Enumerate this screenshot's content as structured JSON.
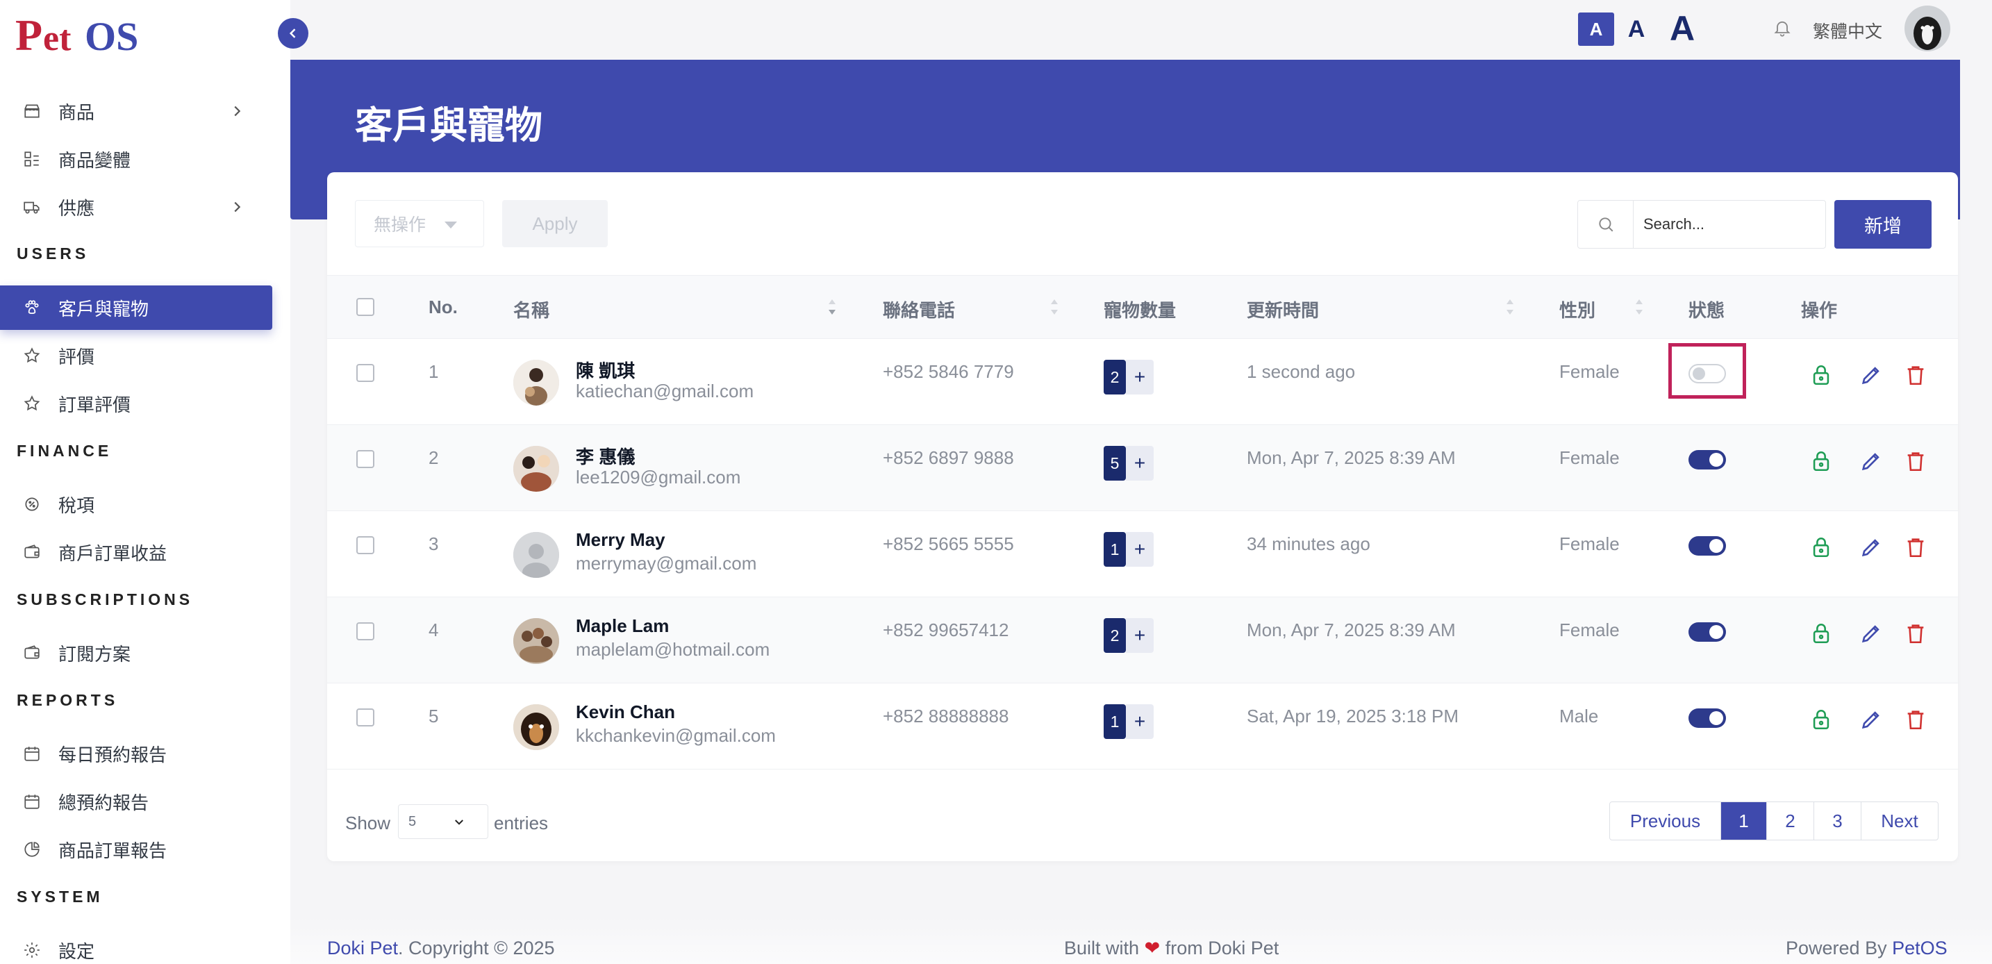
{
  "app": {
    "logo_text": "PetOS",
    "page_title": "客戶與寵物",
    "language": "繁體中文",
    "font_sizes": [
      "A",
      "A",
      "A"
    ]
  },
  "sidebar": {
    "items": [
      {
        "label": "商品",
        "icon": "store-icon",
        "has_children": true
      },
      {
        "label": "商品變體",
        "icon": "variant-icon",
        "has_children": false
      },
      {
        "label": "供應",
        "icon": "truck-icon",
        "has_children": true
      }
    ],
    "sections": [
      {
        "title": "USERS",
        "items": [
          {
            "label": "客戶與寵物",
            "icon": "paw-icon",
            "active": true
          },
          {
            "label": "評價",
            "icon": "star-icon"
          },
          {
            "label": "訂單評價",
            "icon": "star-icon"
          }
        ]
      },
      {
        "title": "FINANCE",
        "items": [
          {
            "label": "稅項",
            "icon": "tax-icon"
          },
          {
            "label": "商戶訂單收益",
            "icon": "wallet-icon"
          }
        ]
      },
      {
        "title": "SUBSCRIPTIONS",
        "items": [
          {
            "label": "訂閱方案",
            "icon": "wallet-icon"
          }
        ]
      },
      {
        "title": "REPORTS",
        "items": [
          {
            "label": "每日預約報告",
            "icon": "calendar-icon"
          },
          {
            "label": "總預約報告",
            "icon": "calendar-icon"
          },
          {
            "label": "商品訂單報告",
            "icon": "pie-chart-icon"
          }
        ]
      },
      {
        "title": "SYSTEM",
        "items": [
          {
            "label": "設定",
            "icon": "gear-icon"
          }
        ]
      }
    ]
  },
  "toolbar": {
    "bulk_action": "無操作",
    "apply_label": "Apply",
    "search_placeholder": "Search...",
    "add_label": "新增"
  },
  "table": {
    "columns": [
      "No.",
      "名稱",
      "聯絡電話",
      "寵物數量",
      "更新時間",
      "性別",
      "狀態",
      "操作"
    ],
    "rows": [
      {
        "no": "1",
        "name": "陳 凱琪",
        "email": "katiechan@gmail.com",
        "phone": "+852 5846 7779",
        "pets": "2",
        "updated": "1 second ago",
        "gender": "Female",
        "active": false
      },
      {
        "no": "2",
        "name": "李 惠儀",
        "email": "lee1209@gmail.com",
        "phone": "+852 6897 9888",
        "pets": "5",
        "updated": "Mon, Apr 7, 2025 8:39 AM",
        "gender": "Female",
        "active": true
      },
      {
        "no": "3",
        "name": "Merry May",
        "email": "merrymay@gmail.com",
        "phone": "+852 5665 5555",
        "pets": "1",
        "updated": "34 minutes ago",
        "gender": "Female",
        "active": true
      },
      {
        "no": "4",
        "name": "Maple Lam",
        "email": "maplelam@hotmail.com",
        "phone": "+852 99657412",
        "pets": "2",
        "updated": "Mon, Apr 7, 2025 8:39 AM",
        "gender": "Female",
        "active": true
      },
      {
        "no": "5",
        "name": "Kevin Chan",
        "email": "kkchankevin@gmail.com",
        "phone": "+852 88888888",
        "pets": "1",
        "updated": "Sat, Apr 19, 2025 3:18 PM",
        "gender": "Male",
        "active": true
      }
    ],
    "pet_add": "+"
  },
  "pagination": {
    "show_label": "Show",
    "entries_value": "5",
    "entries_label": "entries",
    "previous": "Previous",
    "pages": [
      "1",
      "2",
      "3"
    ],
    "current": "1",
    "next": "Next"
  },
  "footer": {
    "brand": "Doki Pet",
    "copyright": ". Copyright © 2025",
    "built_prefix": "Built with",
    "heart": "❤",
    "built_suffix": "from Doki Pet",
    "powered_prefix": "Powered By",
    "powered_brand": "PetOS"
  },
  "colors": {
    "primary": "#3f4aad",
    "navy": "#1a2a6c",
    "highlight": "#c0225a",
    "lock": "#1f9d55",
    "delete": "#d0302f"
  }
}
